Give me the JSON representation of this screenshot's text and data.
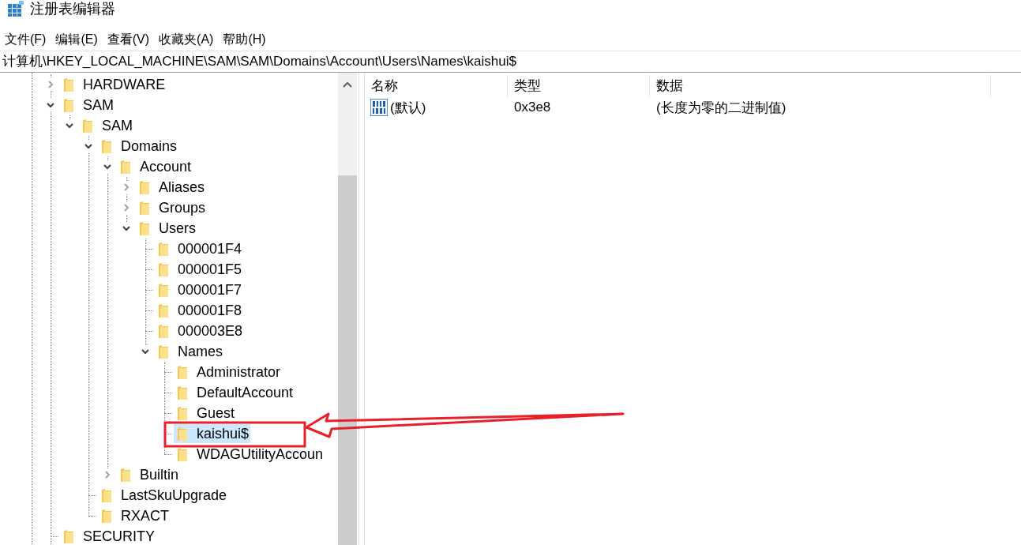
{
  "window": {
    "title": "注册表编辑器"
  },
  "menu": [
    "文件(F)",
    "编辑(E)",
    "查看(V)",
    "收藏夹(A)",
    "帮助(H)"
  ],
  "address": "计算机\\HKEY_LOCAL_MACHINE\\SAM\\SAM\\Domains\\Account\\Users\\Names\\kaishui$",
  "tree": [
    {
      "label": "HARDWARE",
      "selected": false,
      "expanded": false
    },
    {
      "label": "SAM",
      "selected": false,
      "expanded": true,
      "children": [
        {
          "label": "SAM",
          "selected": false,
          "expanded": true,
          "children": [
            {
              "label": "Domains",
              "selected": false,
              "expanded": true,
              "children": [
                {
                  "label": "Account",
                  "selected": false,
                  "expanded": true,
                  "children": [
                    {
                      "label": "Aliases",
                      "selected": false,
                      "expanded": false
                    },
                    {
                      "label": "Groups",
                      "selected": false,
                      "expanded": false
                    },
                    {
                      "label": "Users",
                      "selected": false,
                      "expanded": true,
                      "children": [
                        {
                          "label": "000001F4",
                          "selected": false
                        },
                        {
                          "label": "000001F5",
                          "selected": false
                        },
                        {
                          "label": "000001F7",
                          "selected": false
                        },
                        {
                          "label": "000001F8",
                          "selected": false
                        },
                        {
                          "label": "000003E8",
                          "selected": false
                        },
                        {
                          "label": "Names",
                          "selected": false,
                          "expanded": true,
                          "children": [
                            {
                              "label": "Administrator",
                              "selected": false
                            },
                            {
                              "label": "DefaultAccount",
                              "selected": false
                            },
                            {
                              "label": "Guest",
                              "selected": false
                            },
                            {
                              "label": "kaishui$",
                              "selected": true
                            },
                            {
                              "label": "WDAGUtilityAccoun",
                              "selected": false
                            }
                          ]
                        }
                      ]
                    }
                  ]
                },
                {
                  "label": "Builtin",
                  "selected": false,
                  "expanded": false
                }
              ]
            },
            {
              "label": "LastSkuUpgrade",
              "selected": false
            },
            {
              "label": "RXACT",
              "selected": false
            }
          ]
        }
      ]
    },
    {
      "label": "SECURITY",
      "selected": false
    }
  ],
  "values": {
    "columns": [
      "名称",
      "类型",
      "数据"
    ],
    "rows": [
      {
        "name": "(默认)",
        "type": "0x3e8",
        "data": "(长度为零的二进制值)"
      }
    ]
  }
}
